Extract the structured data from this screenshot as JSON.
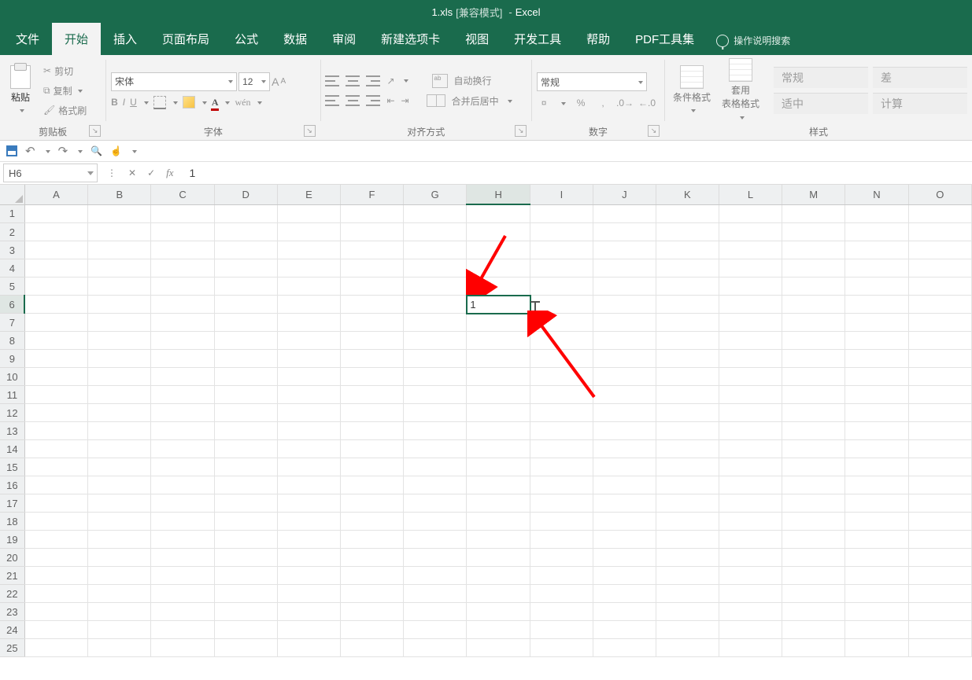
{
  "title": {
    "file": "1.xls",
    "mode": "[兼容模式]",
    "dash": "-",
    "app": "Excel"
  },
  "tabs": {
    "file": "文件",
    "home": "开始",
    "insert": "插入",
    "layout": "页面布局",
    "formulas": "公式",
    "data": "数据",
    "review": "审阅",
    "newtab": "新建选项卡",
    "view": "视图",
    "dev": "开发工具",
    "help": "帮助",
    "pdf": "PDF工具集",
    "tell": "操作说明搜索"
  },
  "clipboard": {
    "paste": "粘贴",
    "cut": "剪切",
    "copy": "复制",
    "painter": "格式刷",
    "group": "剪贴板"
  },
  "font": {
    "name": "宋体",
    "size": "12",
    "bold": "B",
    "italic": "I",
    "underline": "U",
    "group": "字体"
  },
  "align": {
    "wrap": "自动换行",
    "merge": "合并后居中",
    "group": "对齐方式"
  },
  "number": {
    "format": "常规",
    "percent": "%",
    "comma": ",",
    "group": "数字"
  },
  "styles": {
    "cond": "条件格式",
    "table": "套用\n表格格式",
    "group": "样式",
    "cells": {
      "normal": "常规",
      "bad": "差",
      "good": "适中",
      "calc": "计算"
    }
  },
  "fbar": {
    "name": "H6",
    "x": "✕",
    "check": "✓",
    "fx": "fx",
    "value": "1"
  },
  "sheet": {
    "cols": [
      "A",
      "B",
      "C",
      "D",
      "E",
      "F",
      "G",
      "H",
      "I",
      "J",
      "K",
      "L",
      "M",
      "N",
      "O"
    ],
    "rows": [
      "1",
      "2",
      "3",
      "4",
      "5",
      "6",
      "7",
      "8",
      "9",
      "10",
      "11",
      "12",
      "13",
      "14",
      "15",
      "16",
      "17",
      "18",
      "19",
      "20",
      "21",
      "22",
      "23",
      "24",
      "25"
    ],
    "active_col": "H",
    "active_row": "6",
    "cells": {
      "H6": "1"
    }
  }
}
